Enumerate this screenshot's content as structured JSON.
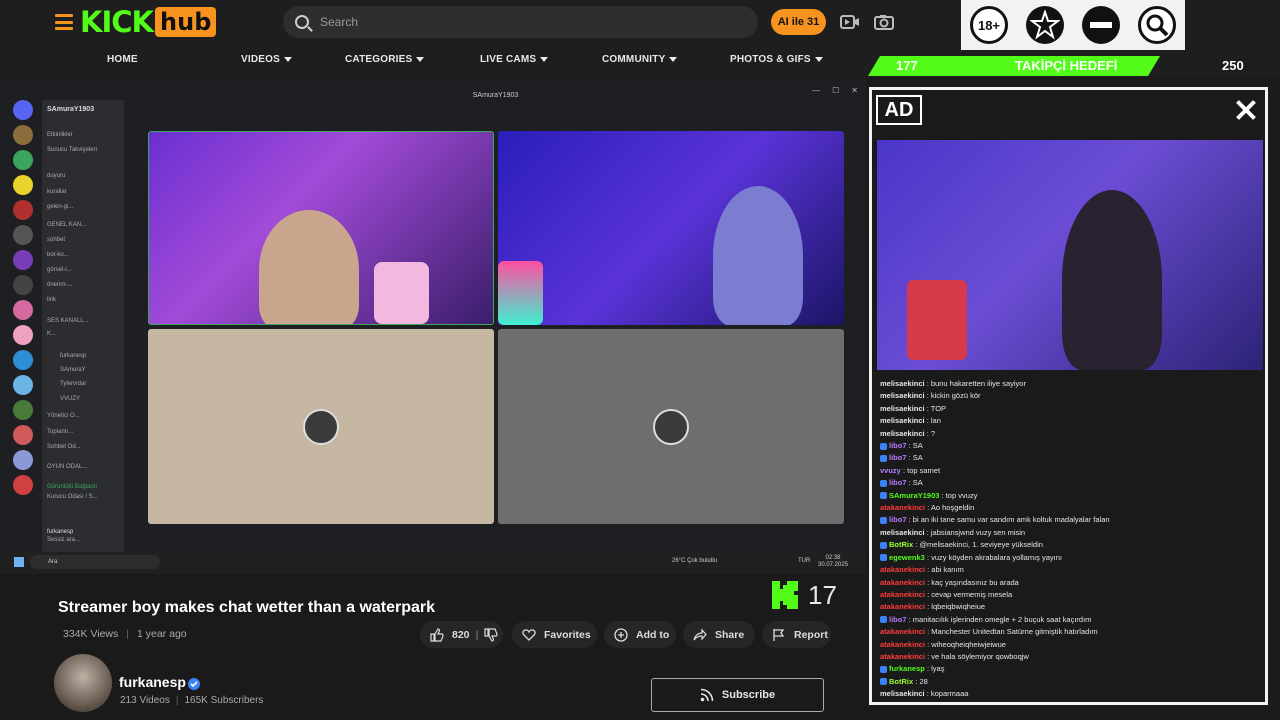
{
  "header": {
    "logo_main": "KICK",
    "logo_badge": "hub",
    "search_placeholder": "Search",
    "ai_badge": "AI ile 31",
    "nav": [
      {
        "label": "HOME",
        "has_caret": false
      },
      {
        "label": "VIDEOS",
        "has_caret": true
      },
      {
        "label": "CATEGORIES",
        "has_caret": true
      },
      {
        "label": "LIVE CAMS",
        "has_caret": true
      },
      {
        "label": "COMMUNITY",
        "has_caret": true
      },
      {
        "label": "PHOTOS & GIFS",
        "has_caret": true
      }
    ],
    "top_icons": [
      "18-plus-icon",
      "star-burst-icon",
      "minus-circle-icon",
      "zoom-icon"
    ],
    "top_icon_18": "18+"
  },
  "goal": {
    "current": "177",
    "label": "TAKİPÇİ HEDEFİ",
    "target": "250",
    "progress_fraction": 0.708
  },
  "player": {
    "window_title": "SAmuraY1903",
    "server_name": "SAmuraY1903",
    "channels": [
      "Etkinlikler",
      "Sunucu Takviyeleri",
      "duyuru",
      "kurallar",
      "gelen-gi...",
      "GENEL KAN...",
      "sohbet",
      "bot-ko...",
      "görsel-i...",
      "önerim-...",
      "link",
      "SES KANALL...",
      "K...",
      "furkanesp",
      "SAmuraY",
      "Tylervıdar",
      "VVUZY",
      "Yönetici O...",
      "Toplantı...",
      "Sohbet Od...",
      "OYUN ODAL..."
    ],
    "voice_status": "Görüntülü Bağlantı",
    "voice_sub": "Kurucu Odası / S...",
    "user_name": "furkanesp",
    "user_status": "Sessiz ara...",
    "taskbar_search": "Ara",
    "weather": "26°C  Çok bulutlu",
    "lang": "TUR",
    "clock_time": "02:38",
    "clock_date": "30.07.2025"
  },
  "ad": {
    "label": "AD"
  },
  "chat": [
    {
      "user": "melisaekinci",
      "text": "bunu hakaretten iliye sayiyor",
      "color": "white"
    },
    {
      "user": "melisaekinci",
      "text": "kickin gözü kör",
      "color": "white"
    },
    {
      "user": "melisaekinci",
      "text": "TOP",
      "color": "white"
    },
    {
      "user": "melisaekinci",
      "text": "lan",
      "color": "white"
    },
    {
      "user": "melisaekinci",
      "text": "?",
      "color": "white"
    },
    {
      "user": "libo7",
      "text": "SA",
      "color": "purple",
      "badges": true
    },
    {
      "user": "libo7",
      "text": "SA",
      "color": "purple",
      "badges": true
    },
    {
      "user": "vvuzy",
      "text": "top samet",
      "color": "purple"
    },
    {
      "user": "libo7",
      "text": "SA",
      "color": "purple",
      "badges": true
    },
    {
      "user": "SAmuraY1903",
      "text": "top vvuzy",
      "color": "green",
      "badges": true
    },
    {
      "user": "atakanekinci",
      "text": "Ao hoşgeldin",
      "color": "red"
    },
    {
      "user": "libo7",
      "text": "bi an iki tane samu var sandım amk koltuk madalyalar falan",
      "color": "purple",
      "badges": true
    },
    {
      "user": "melisaekinci",
      "text": "jabsiansjwnd vuzy sen misin",
      "color": "white"
    },
    {
      "user": "BotRix",
      "text": "@melisaekinci, 1. seviyeye yükseldin",
      "color": "lime",
      "badges": true
    },
    {
      "user": "egewenk3",
      "text": "vuzy köyden akrabalara yollamış yayını",
      "color": "green",
      "badges": true
    },
    {
      "user": "atakanekinci",
      "text": "abi kanım",
      "color": "red"
    },
    {
      "user": "atakanekinci",
      "text": "kaç yaşındasınız bu arada",
      "color": "red"
    },
    {
      "user": "atakanekinci",
      "text": "cevap vermemiş mesela",
      "color": "red"
    },
    {
      "user": "atakanekinci",
      "text": "lqbeiqbwiqheiue",
      "color": "red"
    },
    {
      "user": "libo7",
      "text": "manitacılık işlerinden omegle + 2 buçuk saat kaçırdım",
      "color": "purple",
      "badges": true
    },
    {
      "user": "atakanekinci",
      "text": "Manchester Unitedtan Satürne gitmiştik hatırladım",
      "color": "red"
    },
    {
      "user": "atakanekinci",
      "text": "wiheoqheiqheiwjeiwue",
      "color": "red"
    },
    {
      "user": "atakanekinci",
      "text": "ve hala söylemiyor qowboqjw",
      "color": "red"
    },
    {
      "user": "furkanesp",
      "text": "lyaş",
      "color": "green",
      "badges": true
    },
    {
      "user": "BotRix",
      "text": "28",
      "color": "lime",
      "badges": true
    },
    {
      "user": "melisaekinci",
      "text": "koparmaaa",
      "color": "white"
    }
  ],
  "video": {
    "kicks": "17",
    "title": "Streamer boy makes chat wetter than a waterpark",
    "views": "334K Views",
    "age": "1 year ago",
    "likes": "820",
    "favorites_label": "Favorites",
    "add_label": "Add to",
    "share_label": "Share",
    "report_label": "Report"
  },
  "channel": {
    "name": "furkanesp",
    "videos": "213 Videos",
    "subscribers": "165K Subscribers",
    "subscribe_label": "Subscribe"
  },
  "colors": {
    "brand_green": "#53fc18",
    "brand_orange": "#f7931e"
  }
}
